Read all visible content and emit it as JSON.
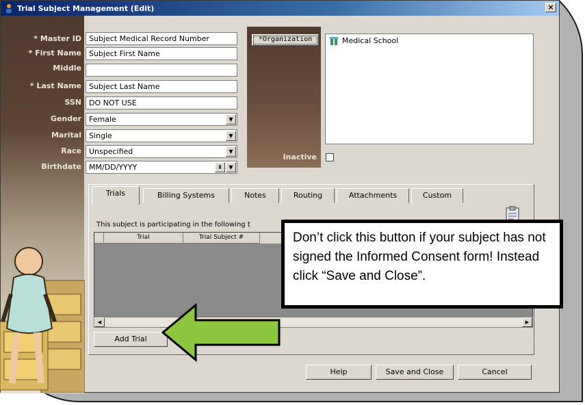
{
  "window": {
    "title": "Trial Subject Management (Edit)",
    "close_label": "×"
  },
  "fields": {
    "master_id": {
      "label": "* Master ID",
      "value": "Subject Medical Record Number"
    },
    "first_name": {
      "label": "* First Name",
      "value": "Subject First Name"
    },
    "middle": {
      "label": "Middle",
      "value": ""
    },
    "last_name": {
      "label": "* Last Name",
      "value": "Subject Last Name"
    },
    "ssn": {
      "label": "SSN",
      "value": "DO NOT USE"
    },
    "gender": {
      "label": "Gender",
      "value": "Female"
    },
    "marital": {
      "label": "Marital",
      "value": "Single"
    },
    "race": {
      "label": "Race",
      "value": "Unspecified"
    },
    "birthdate": {
      "label": "Birthdate",
      "value": "MM/DD/YYYY"
    }
  },
  "organization": {
    "button_label": "*Organization",
    "tree_item": "Medical School"
  },
  "inactive": {
    "label": "Inactive"
  },
  "tabs": [
    {
      "label": "Trials"
    },
    {
      "label": "Billing Systems"
    },
    {
      "label": "Notes"
    },
    {
      "label": "Routing"
    },
    {
      "label": "Attachments"
    },
    {
      "label": "Custom"
    }
  ],
  "trials_tab": {
    "hint": "This subject is participating in the following t",
    "columns": [
      "Trial",
      "Trial Subject #"
    ],
    "add_trial_label": "Add Trial"
  },
  "footer": {
    "help_label": "Help",
    "save_close_label": "Save and Close",
    "cancel_label": "Cancel"
  },
  "callout": {
    "text": "Don’t click this button if your subject has not signed the Informed Consent form! Instead click “Save and Close”."
  },
  "colors": {
    "arrow_fill": "#8cc63f",
    "panel_brown": "#4f3a2e",
    "titlebar": "#0a246a"
  }
}
